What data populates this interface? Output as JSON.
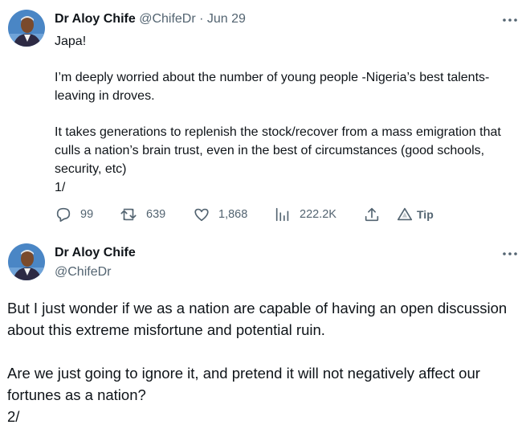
{
  "tweet1": {
    "author_name": "Dr Aloy Chife",
    "handle": "@ChifeDr",
    "separator": " · ",
    "date": "Jun 29",
    "paragraphs": [
      "Japa!",
      "I’m deeply worried about the number of young people -Nigeria’s best talents- leaving in droves.",
      "It takes generations to replenish the stock/recover from a mass emigration that culls a nation’s brain trust, even in the best of circumstances (good schools, security, etc)\n1/"
    ],
    "actions": {
      "replies": "99",
      "retweets": "639",
      "likes": "1,868",
      "views": "222.2K",
      "tip_label": "Tip"
    }
  },
  "tweet2": {
    "author_name": "Dr Aloy Chife",
    "handle": "@ChifeDr",
    "paragraphs": [
      "But I just wonder if we as a nation are capable of having an open discussion about this extreme misfortune and potential ruin.",
      "Are we just going to ignore it, and pretend it will not negatively affect our fortunes as a nation?\n2/"
    ]
  },
  "colors": {
    "text": "#0f1419",
    "secondary": "#536471",
    "avatar_background": "#4a86c5",
    "avatar_suit": "#2d2a44"
  },
  "icons": [
    "avatar",
    "more-options-icon",
    "reply-icon",
    "retweet-icon",
    "like-icon",
    "views-icon",
    "share-icon",
    "tip-icon"
  ]
}
